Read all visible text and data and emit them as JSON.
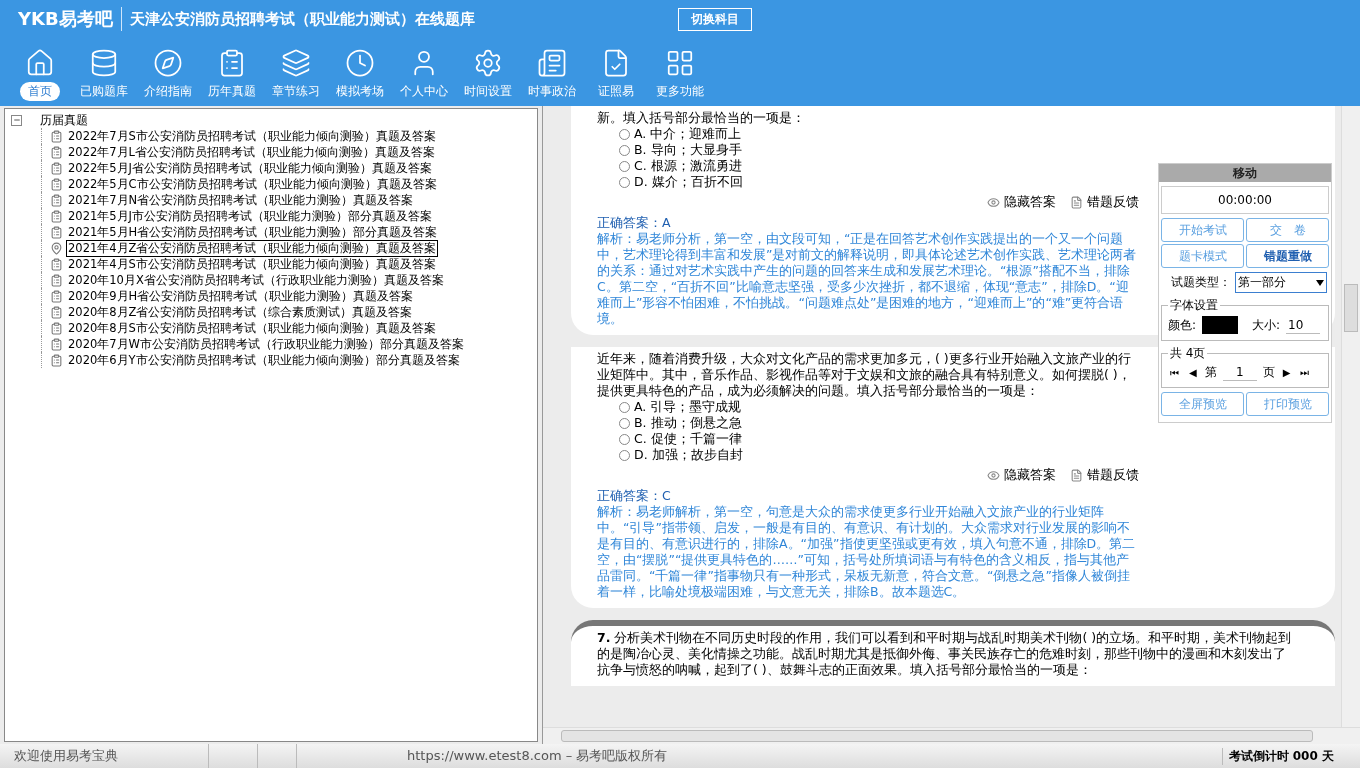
{
  "header": {
    "logo": "YKB易考吧",
    "title": "天津公安消防员招聘考试（职业能力测试）在线题库",
    "switch_button": "切换科目"
  },
  "nav": [
    {
      "label": "首页",
      "selected": true
    },
    {
      "label": "已购题库",
      "selected": false
    },
    {
      "label": "介绍指南",
      "selected": false
    },
    {
      "label": "历年真题",
      "selected": false
    },
    {
      "label": "章节练习",
      "selected": false
    },
    {
      "label": "模拟考场",
      "selected": false
    },
    {
      "label": "个人中心",
      "selected": false
    },
    {
      "label": "时间设置",
      "selected": false
    },
    {
      "label": "时事政治",
      "selected": false
    },
    {
      "label": "证照易",
      "selected": false
    },
    {
      "label": "更多功能",
      "selected": false
    }
  ],
  "tree": {
    "label": "历届真题",
    "expanded": true,
    "children": [
      {
        "label": "2022年7月S市公安消防员招聘考试（职业能力倾向测验）真题及答案",
        "selected": false
      },
      {
        "label": "2022年7月L省公安消防员招聘考试（职业能力倾向测验）真题及答案",
        "selected": false
      },
      {
        "label": "2022年5月J省公安消防员招聘考试（职业能力倾向测验）真题及答案",
        "selected": false
      },
      {
        "label": "2022年5月C市公安消防员招聘考试（职业能力倾向测验）真题及答案",
        "selected": false
      },
      {
        "label": "2021年7月N省公安消防员招聘考试（职业能力测验）真题及答案",
        "selected": false
      },
      {
        "label": "2021年5月J市公安消防员招聘考试（职业能力测验）部分真题及答案",
        "selected": false
      },
      {
        "label": "2021年5月H省公安消防员招聘考试（职业能力测验）部分真题及答案",
        "selected": false
      },
      {
        "label": "2021年4月Z省公安消防员招聘考试（职业能力倾向测验）真题及答案",
        "selected": true
      },
      {
        "label": "2021年4月S市公安消防员招聘考试（职业能力倾向测验）真题及答案",
        "selected": false
      },
      {
        "label": "2020年10月X省公安消防员招聘考试（行政职业能力测验）真题及答案",
        "selected": false
      },
      {
        "label": "2020年9月H省公安消防员招聘考试（职业能力测验）真题及答案",
        "selected": false
      },
      {
        "label": "2020年8月Z省公安消防员招聘考试（综合素质测试）真题及答案",
        "selected": false
      },
      {
        "label": "2020年8月S市公安消防员招聘考试（职业能力倾向测验）真题及答案",
        "selected": false
      },
      {
        "label": "2020年7月W市公安消防员招聘考试（行政职业能力测验）部分真题及答案",
        "selected": false
      },
      {
        "label": "2020年6月Y市公安消防员招聘考试（职业能力倾向测验）部分真题及答案",
        "selected": false
      }
    ]
  },
  "questions": [
    {
      "kind": "answered",
      "stem": "新。填入括号部分最恰当的一项是：",
      "options": [
        {
          "text": "A. 中介；迎难而上",
          "selected": false
        },
        {
          "text": "B. 导向；大显身手",
          "selected": false
        },
        {
          "text": "C. 根源；激流勇进",
          "selected": false
        },
        {
          "text": "D. 媒介；百折不回",
          "selected": false
        }
      ],
      "hide_answer": "隐藏答案",
      "feedback": "错题反馈",
      "answer": "正确答案：A",
      "analysis": "解析：易老师分析，第一空，由文段可知，“正是在回答艺术创作实践提出的一个又一个问题中，艺术理论得到丰富和发展”是对前文的解释说明，即具体论述艺术创作实践、艺术理论两者的关系：通过对艺术实践中产生的问题的回答来生成和发展艺术理论。“根源”搭配不当，排除C。第二空，“百折不回”比喻意志坚强，受多少次挫折，都不退缩，体现“意志”，排除D。“迎难而上”形容不怕困难，不怕挑战。“问题难点处”是困难的地方，“迎难而上”的“难”更符合语境。"
    },
    {
      "kind": "answered",
      "stem": "近年来，随着消费升级，大众对文化产品的需求更加多元，( )更多行业开始融入文旅产业的行业矩阵中。其中，音乐作品、影视作品等对于文娱和文旅的融合具有特别意义。如何摆脱( )，提供更具特色的产品，成为必须解决的问题。填入括号部分最恰当的一项是：",
      "options": [
        {
          "text": "A. 引导；墨守成规",
          "selected": false
        },
        {
          "text": "B. 推动；倒悬之急",
          "selected": false
        },
        {
          "text": "C. 促使；千篇一律",
          "selected": false
        },
        {
          "text": "D. 加强；故步自封",
          "selected": false
        }
      ],
      "hide_answer": "隐藏答案",
      "feedback": "错题反馈",
      "answer": "正确答案：C",
      "analysis": "解析：易老师解析，第一空，句意是大众的需求使更多行业开始融入文旅产业的行业矩阵中。“引导”指带领、启发，一般是有目的、有意识、有计划的。大众需求对行业发展的影响不是有目的、有意识进行的，排除A。“加强”指使更坚强或更有效，填入句意不通，排除D。第二空，由“摆脱”“提供更具特色的……”可知，括号处所填词语与有特色的含义相反，指与其他产品雷同。“千篇一律”指事物只有一种形式，呆板无新意，符合文意。“倒悬之急”指像人被倒挂着一样，比喻处境极端困难，与文意无关，排除B。故本题选C。"
    },
    {
      "kind": "stem_only",
      "number": "7.",
      "stem": "分析美术刊物在不同历史时段的作用，我们可以看到和平时期与战乱时期美术刊物( )的立场。和平时期，美术刊物起到的是陶冶心灵、美化情操之功能。战乱时期尤其是抵御外侮、事关民族存亡的危难时刻，那些刊物中的漫画和木刻发出了抗争与愤怒的呐喊，起到了( )、鼓舞斗志的正面效果。填入括号部分最恰当的一项是："
    }
  ],
  "panel": {
    "title": "移动",
    "timer": "00:00:00",
    "buttons": [
      {
        "label": "开始考试",
        "active": false
      },
      {
        "label": "交　卷",
        "active": false
      },
      {
        "label": "题卡模式",
        "active": false
      },
      {
        "label": "错题重做",
        "active": true
      }
    ],
    "type_label": "试题类型：",
    "type_value": "第一部分",
    "font_group": "字体设置",
    "color_label": "颜色:",
    "size_label": "大小:",
    "size_value": "10",
    "pages_group": "共 4页",
    "page_prefix": "第",
    "page_value": "1",
    "page_suffix": "页",
    "first": "⏮",
    "prev": "◀",
    "next": "▶",
    "last": "⏭",
    "fullscreen": "全屏预览",
    "print": "打印预览"
  },
  "status_bar": {
    "welcome": "欢迎使用易考宝典",
    "copyright": "https://www.etest8.com – 易考吧版权所有",
    "countdown": "考试倒计时 000 天"
  }
}
